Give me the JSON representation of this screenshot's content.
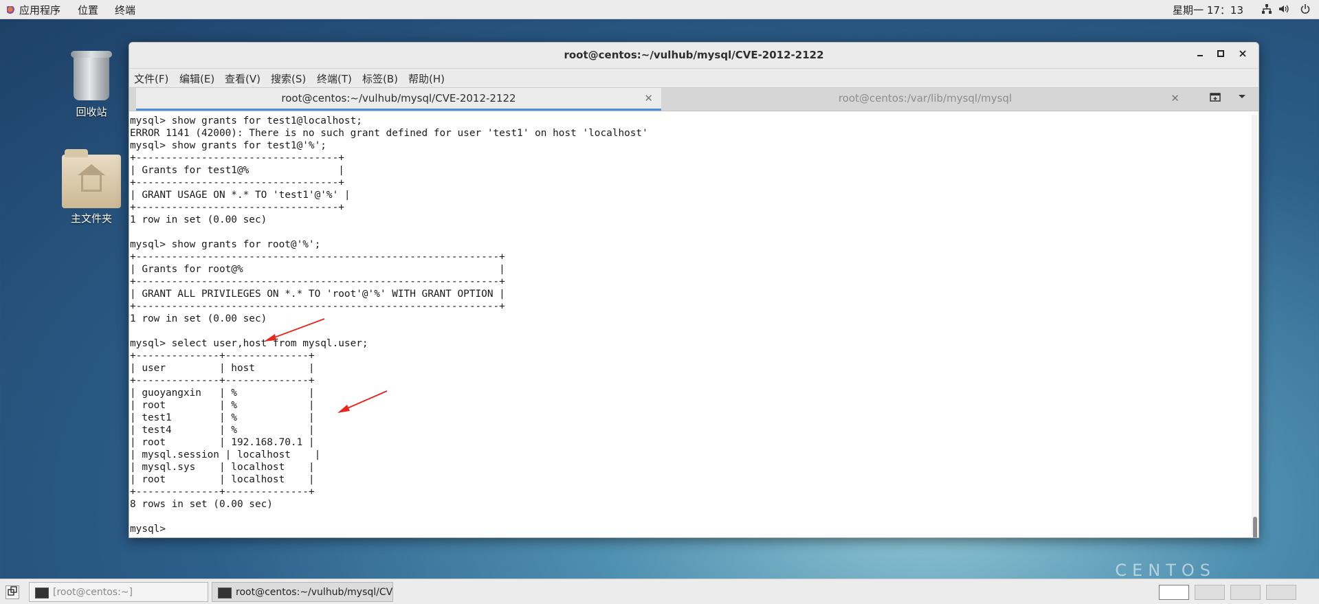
{
  "top_panel": {
    "apps_menu": "应用程序",
    "places_menu": "位置",
    "terminal_menu": "终端",
    "clock": "星期一 17：13",
    "icons": [
      "network-icon",
      "volume-icon",
      "power-icon"
    ]
  },
  "desktop": {
    "trash_label": "回收站",
    "home_label": "主文件夹",
    "watermark": "CENTOS"
  },
  "window": {
    "title": "root@centos:~/vulhub/mysql/CVE-2012-2122",
    "menu": [
      "文件(F)",
      "编辑(E)",
      "查看(V)",
      "搜索(S)",
      "终端(T)",
      "标签(B)",
      "帮助(H)"
    ],
    "tabs": [
      {
        "label": "root@centos:~/vulhub/mysql/CVE-2012-2122",
        "active": true
      },
      {
        "label": "root@centos:/var/lib/mysql/mysql",
        "active": false
      }
    ],
    "terminal_lines": [
      "mysql> show grants for test1@localhost;",
      "ERROR 1141 (42000): There is no such grant defined for user 'test1' on host 'localhost'",
      "mysql> show grants for test1@'%';",
      "+----------------------------------+",
      "| Grants for test1@%               |",
      "+----------------------------------+",
      "| GRANT USAGE ON *.* TO 'test1'@'%' |",
      "+----------------------------------+",
      "1 row in set (0.00 sec)",
      "",
      "mysql> show grants for root@'%';",
      "+-------------------------------------------------------------+",
      "| Grants for root@%                                           |",
      "+-------------------------------------------------------------+",
      "| GRANT ALL PRIVILEGES ON *.* TO 'root'@'%' WITH GRANT OPTION |",
      "+-------------------------------------------------------------+",
      "1 row in set (0.00 sec)",
      "",
      "mysql> select user,host from mysql.user;",
      "+--------------+--------------+",
      "| user         | host         |",
      "+--------------+--------------+",
      "| guoyangxin   | %            |",
      "| root         | %            |",
      "| test1        | %            |",
      "| test4        | %            |",
      "| root         | 192.168.70.1 |",
      "| mysql.session | localhost    |",
      "| mysql.sys    | localhost    |",
      "| root         | localhost    |",
      "+--------------+--------------+",
      "8 rows in set (0.00 sec)",
      "",
      "mysql> "
    ]
  },
  "taskbar": {
    "tasks": [
      {
        "label": "[root@centos:~]",
        "active": false
      },
      {
        "label": "root@centos:~/vulhub/mysql/CVE-2…",
        "active": true
      }
    ],
    "workspaces": 4
  },
  "colors": {
    "arrow": "#e8281e",
    "tab_accent": "#4a90d9"
  }
}
